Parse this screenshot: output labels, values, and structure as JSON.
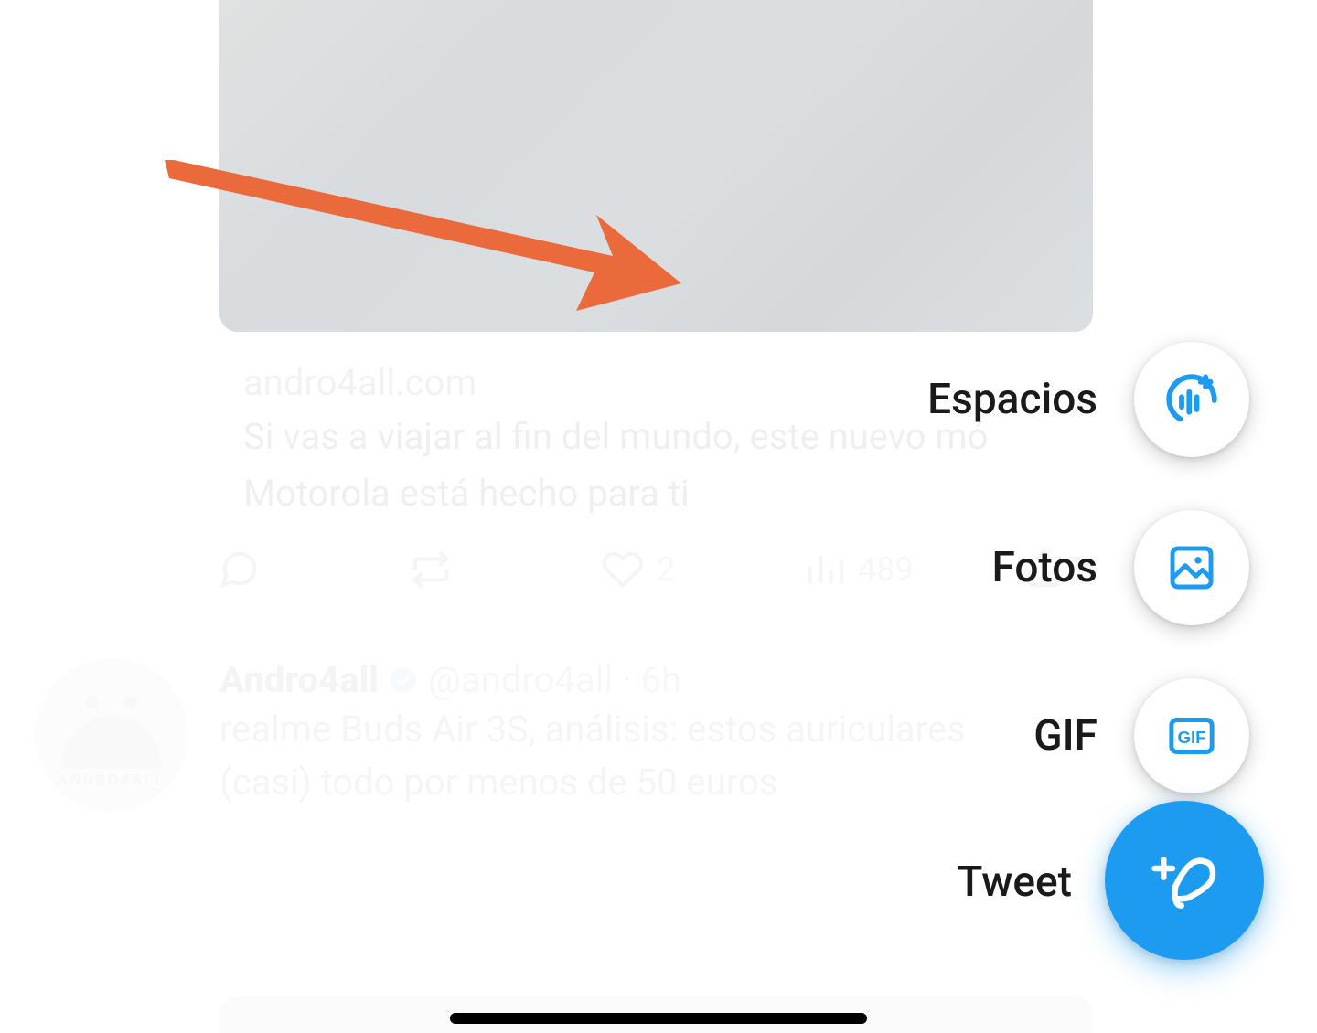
{
  "fab": {
    "items": [
      {
        "key": "spaces",
        "label": "Espacios",
        "icon": "spaces-icon"
      },
      {
        "key": "photos",
        "label": "Fotos",
        "icon": "photo-icon"
      },
      {
        "key": "gif",
        "label": "GIF",
        "icon": "gif-icon"
      }
    ],
    "main": {
      "label": "Tweet",
      "icon": "compose-icon"
    }
  },
  "timeline": {
    "link_card": {
      "domain": "andro4all.com",
      "title_line1": "Si vas a viajar al fin del mundo, este nuevo mó",
      "title_line2": "Motorola está hecho para ti"
    },
    "actions": {
      "reply_count": "",
      "retweet_count": "",
      "like_count": "2",
      "views_count": "489"
    },
    "next_tweet": {
      "author_name": "Andro4all",
      "author_handle": "@andro4all",
      "time": "6h",
      "avatar_text": "ANDRO4ALL",
      "text_line1": "realme Buds Air 3S, análisis: estos auriculares",
      "text_line2": "(casi) todo por menos de 50 euros"
    }
  },
  "colors": {
    "accent": "#1d9bf0",
    "annotation": "#eb6a3c"
  }
}
